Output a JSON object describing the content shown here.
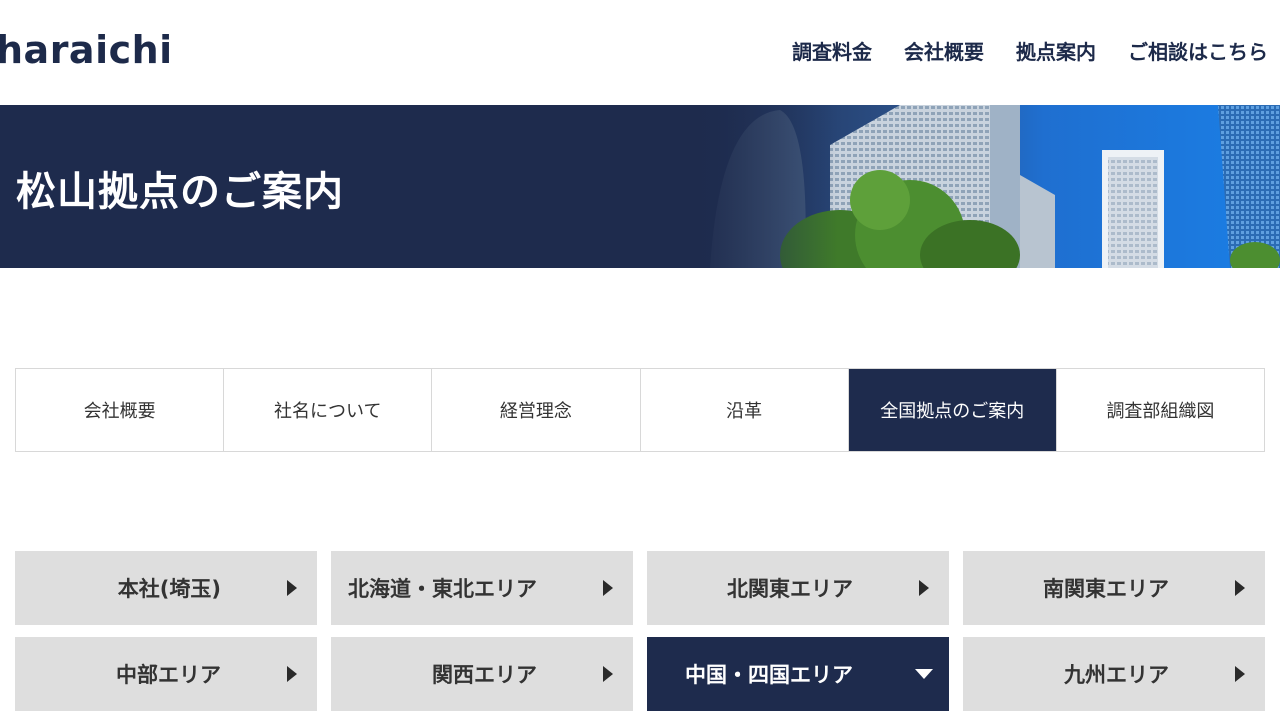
{
  "header": {
    "logo": "haraichi",
    "nav": [
      "調査料金",
      "会社概要",
      "拠点案内",
      "ご相談はこちら"
    ]
  },
  "hero": {
    "title": "松山拠点のご案内"
  },
  "tabs": [
    {
      "label": "会社概要",
      "active": false
    },
    {
      "label": "社名について",
      "active": false
    },
    {
      "label": "経営理念",
      "active": false
    },
    {
      "label": "沿革",
      "active": false
    },
    {
      "label": "全国拠点のご案内",
      "active": true
    },
    {
      "label": "調査部組織図",
      "active": false
    }
  ],
  "areas": [
    {
      "label": "本社(埼玉)",
      "active": false
    },
    {
      "label": "北海道・東北エリア",
      "active": false
    },
    {
      "label": "北関東エリア",
      "active": false
    },
    {
      "label": "南関東エリア",
      "active": false
    },
    {
      "label": "中部エリア",
      "active": false
    },
    {
      "label": "関西エリア",
      "active": false
    },
    {
      "label": "中国・四国エリア",
      "active": true
    },
    {
      "label": "九州エリア",
      "active": false
    }
  ],
  "colors": {
    "navy": "#1e2b4d",
    "gray": "#dedede"
  }
}
